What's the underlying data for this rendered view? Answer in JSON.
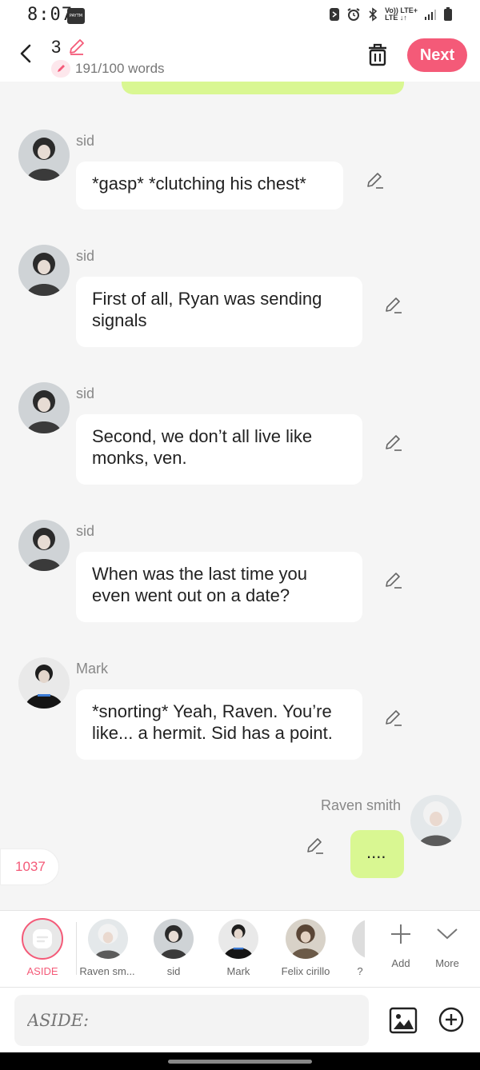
{
  "status_bar": {
    "time": "8:07",
    "badge": "PAYTM",
    "network_top": "Vo)) LTE+",
    "network_bottom": "LTE ↓↑"
  },
  "header": {
    "count": "3",
    "words": "191/100 words",
    "next_label": "Next"
  },
  "messages": [
    {
      "sender": "sid",
      "text": "*gasp* *clutching his chest*"
    },
    {
      "sender": "sid",
      "text": "First of all, Ryan was sending signals"
    },
    {
      "sender": "sid",
      "text": "Second, we don’t all live like monks, ven."
    },
    {
      "sender": "sid",
      "text": "When was the last time you even went out on a date?"
    },
    {
      "sender": "Mark",
      "text": "*snorting* Yeah, Raven. You’re like... a hermit. Sid has a point."
    },
    {
      "sender": "Raven smith",
      "text": "...."
    }
  ],
  "word_badge": "1037",
  "characters": {
    "aside": "ASIDE",
    "items": [
      "Raven sm...",
      "sid",
      "Mark",
      "Felix cirillo",
      "?"
    ],
    "add": "Add",
    "more": "More"
  },
  "input": {
    "placeholder": "ASIDE:"
  },
  "colors": {
    "accent": "#f45a78",
    "user_bubble": "#d9f792",
    "background": "#f5f5f5"
  }
}
